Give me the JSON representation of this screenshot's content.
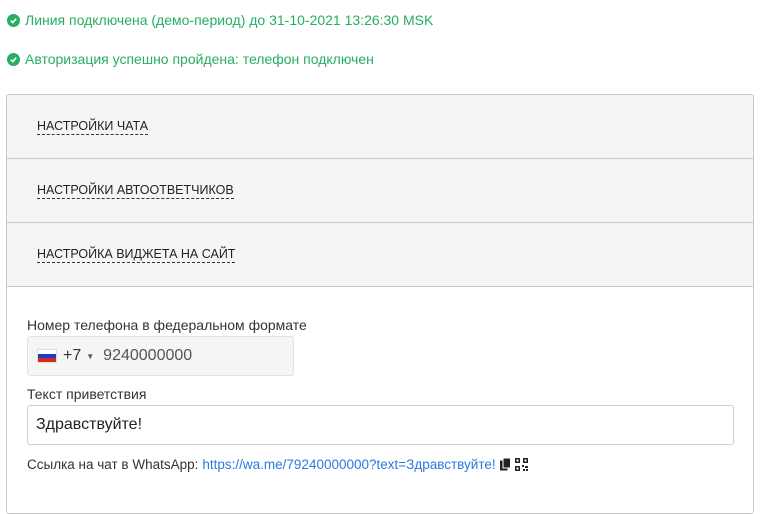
{
  "status": {
    "line": "Линия подключена (демо-период) до 31-10-2021 13:26:30 MSK",
    "auth": "Авторизация успешно пройдена: телефон подключен",
    "color": "#27ae60"
  },
  "accordion": {
    "items": [
      {
        "label": "Настройки чата"
      },
      {
        "label": "Настройки автоответчиков"
      },
      {
        "label": "Настройка виджета на сайт"
      }
    ]
  },
  "widget": {
    "phone_label": "Номер телефона в федеральном формате",
    "country_code": "+7",
    "phone_value": "9240000000",
    "greeting_label": "Текст приветствия",
    "greeting_value": "Здравствуйте!",
    "link_label": "Ссылка на чат в WhatsApp:",
    "link_url": "https://wa.me/79240000000?text=Здравствуйте!",
    "icons": [
      "copy-icon",
      "qr-code-icon"
    ]
  }
}
